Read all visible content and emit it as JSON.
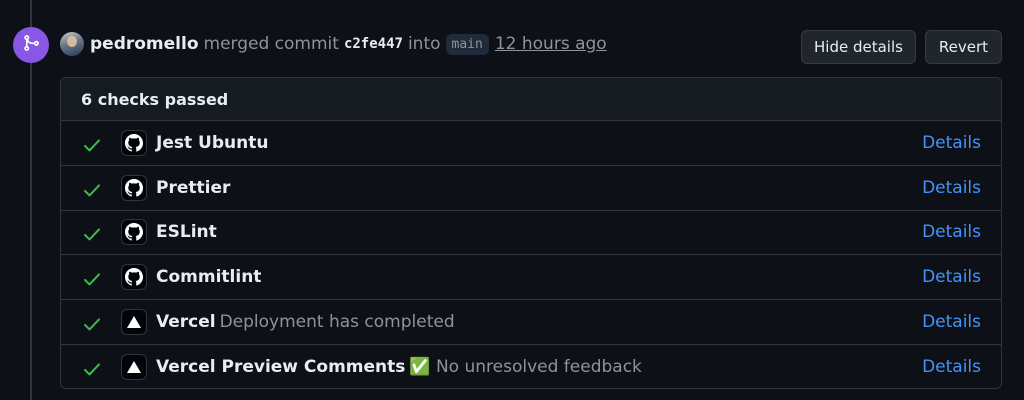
{
  "header": {
    "username": "pedromello",
    "action_text": "merged commit",
    "commit_sha": "c2fe447",
    "into_text": "into",
    "branch": "main",
    "time": "12 hours ago"
  },
  "buttons": {
    "hide_details": "Hide details",
    "revert": "Revert"
  },
  "checks": {
    "summary": "6 checks passed",
    "items": [
      {
        "name": "Jest Ubuntu",
        "description": "",
        "icon": "github-icon",
        "link": "Details",
        "status": "passed"
      },
      {
        "name": "Prettier",
        "description": "",
        "icon": "github-icon",
        "link": "Details",
        "status": "passed"
      },
      {
        "name": "ESLint",
        "description": "",
        "icon": "github-icon",
        "link": "Details",
        "status": "passed"
      },
      {
        "name": "Commitlint",
        "description": "",
        "icon": "github-icon",
        "link": "Details",
        "status": "passed"
      },
      {
        "name": "Vercel",
        "description": "Deployment has completed",
        "icon": "vercel-icon",
        "link": "Details",
        "status": "passed"
      },
      {
        "name": "Vercel Preview Comments",
        "description": "✅ No unresolved feedback",
        "icon": "vercel-icon",
        "link": "Details",
        "status": "passed"
      }
    ]
  },
  "colors": {
    "background": "#0d1117",
    "merge_badge": "#8957e5",
    "link": "#4493f8",
    "success": "#3fb950"
  }
}
